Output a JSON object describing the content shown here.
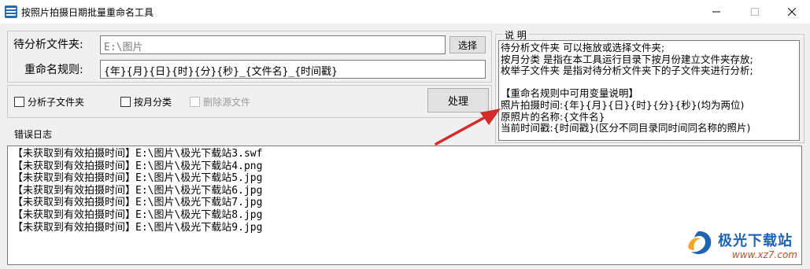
{
  "window": {
    "title": "按照片拍摄日期批量重命名工具"
  },
  "form": {
    "folder_label": "待分析文件夹:",
    "folder_value": "E:\\图片",
    "select_button": "选择",
    "rename_label": "重命名规则:",
    "rename_value": "{年}{月}{日}{时}{分}{秒}_{文件名}_{时间戳}"
  },
  "options": {
    "analyze_subfolders": "分析子文件夹",
    "by_month": "按月分类",
    "delete_source": "删除源文件",
    "process_button": "处理"
  },
  "help": {
    "title": "说 明",
    "lines": [
      "待分析文件夹 可以拖放或选择文件夹;",
      "按月分类 是指在本工具运行目录下按月份建立文件夹存放;",
      "枚举子文件夹 是指对待分析文件夹下的子文件夹进行分析;",
      "",
      "【重命名规则中可用变量说明】",
      "照片拍摄时间:{年}{月}{日}{时}{分}{秒}(均为两位)",
      "原照片的名称:{文件名}",
      "当前时间戳:{时间戳}(区分不同目录同时间同名称的照片)"
    ]
  },
  "log": {
    "label": "错误日志",
    "lines": [
      "【未获取到有效拍摄时间】E:\\图片\\极光下载站3.swf",
      "【未获取到有效拍摄时间】E:\\图片\\极光下载站4.png",
      "【未获取到有效拍摄时间】E:\\图片\\极光下载站5.jpg",
      "【未获取到有效拍摄时间】E:\\图片\\极光下载站6.jpg",
      "【未获取到有效拍摄时间】E:\\图片\\极光下载站7.jpg",
      "【未获取到有效拍摄时间】E:\\图片\\极光下载站8.jpg",
      "【未获取到有效拍摄时间】E:\\图片\\极光下载站9.jpg"
    ]
  },
  "watermark": {
    "name": "极光下载站",
    "url": "www.xz7.com"
  },
  "colors": {
    "accent": "#1f63b5",
    "arrow": "#d42a2a",
    "watermark_url": "#d2461f"
  },
  "icons": {
    "app": "app-icon",
    "minimize": "minimize-icon",
    "maximize": "maximize-icon",
    "close": "close-icon",
    "arrow": "red-arrow-icon"
  }
}
